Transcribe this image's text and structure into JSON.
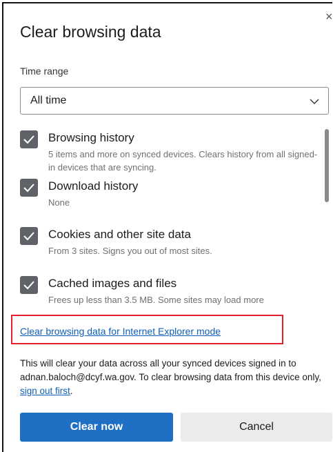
{
  "dialog": {
    "title": "Clear browsing data",
    "close_icon": "×"
  },
  "time_range": {
    "label": "Time range",
    "selected": "All time",
    "icon": "chevron-down-icon"
  },
  "options": [
    {
      "label": "Browsing history",
      "description": "5 items and more on synced devices. Clears history from all signed-in devices that are syncing.",
      "checked": true
    },
    {
      "label": "Download history",
      "description": "None",
      "checked": true
    },
    {
      "label": "Cookies and other site data",
      "description": "From 3 sites. Signs you out of most sites.",
      "checked": true
    },
    {
      "label": "Cached images and files",
      "description": "Frees up less than 3.5 MB. Some sites may load more",
      "checked": true
    }
  ],
  "ie_link": "Clear browsing data for Internet Explorer mode",
  "info": {
    "text_before": "This will clear your data across all your synced devices signed in to adnan.baloch@dcyf.wa.gov. To clear browsing data from this device only, ",
    "link": "sign out first",
    "text_after": "."
  },
  "buttons": {
    "clear": "Clear now",
    "cancel": "Cancel"
  },
  "colors": {
    "primary": "#1f6fc5",
    "checkbox": "#5f6368",
    "highlight_border": "#e3202b",
    "link": "#0f5fb8"
  }
}
